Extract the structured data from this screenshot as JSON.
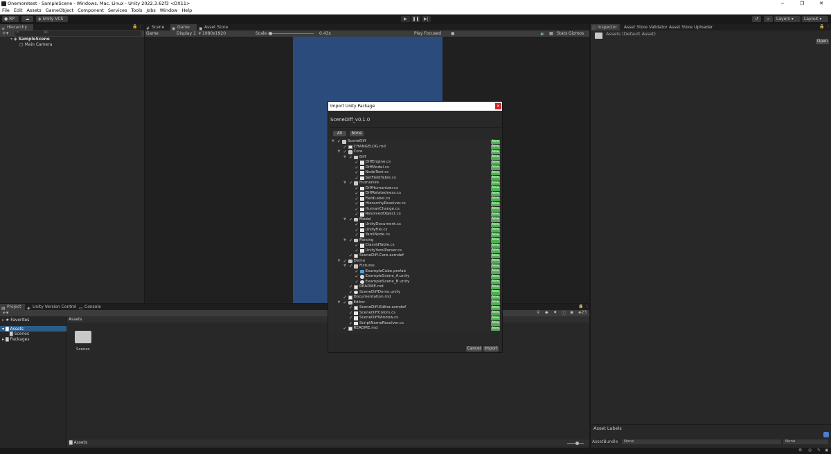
{
  "window": {
    "title": "Onemoretest - SampleScene - Windows, Mac, Linux - Unity 2022.3.62f3 <DX11>",
    "controls": [
      "─",
      "❐",
      "✕"
    ]
  },
  "menu": [
    "File",
    "Edit",
    "Assets",
    "GameObject",
    "Component",
    "Services",
    "Tools",
    "Jobs",
    "Window",
    "Help"
  ],
  "toolbar": {
    "account": "RP",
    "vcs": "Unity VCS",
    "layers": "Layers",
    "layout": "Layout"
  },
  "hierarchy": {
    "tab": "Hierarchy",
    "search_placeholder": "All",
    "scene": "SampleScene",
    "items": [
      "Main Camera"
    ]
  },
  "center": {
    "tabs": [
      "Scene",
      "Game",
      "Asset Store"
    ],
    "game_label": "Game",
    "display": "Display 1",
    "resolution": "1080x1920",
    "scale_label": "Scale",
    "scale_value": "0.43x",
    "play_mode": "Play Focused",
    "stats": "Stats",
    "gizmos": "Gizmos"
  },
  "inspector": {
    "tabs": [
      "Inspector",
      "Asset Store Validator",
      "Asset Store Uploader"
    ],
    "header": "Assets (Default Asset)",
    "open_button": "Open",
    "asset_labels": "Asset Labels",
    "asset_bundle_label": "AssetBundle",
    "asset_bundle_value": "None",
    "asset_bundle_variant": "None"
  },
  "project": {
    "tabs": [
      "Project",
      "Unity Version Control",
      "Console"
    ],
    "favorites": "Favorites",
    "tree": [
      {
        "label": "Assets",
        "level": 0
      },
      {
        "label": "Scenes",
        "level": 1
      },
      {
        "label": "Packages",
        "level": 0
      }
    ],
    "breadcrumb": "Assets",
    "folders": [
      "Scenes"
    ],
    "footer_path": "Assets",
    "hidden_count": "23"
  },
  "dialog": {
    "title": "Import Unity Package",
    "package": "SceneDiff_v0.1.0",
    "all_button": "All",
    "none_button": "None",
    "new_badge": "New",
    "cancel_button": "Cancel",
    "import_button": "Import",
    "items": [
      {
        "label": "SceneDiff",
        "depth": 0,
        "kind": "folder",
        "expand": true
      },
      {
        "label": "CHANGELOG.md",
        "depth": 1,
        "kind": "file"
      },
      {
        "label": "Core",
        "depth": 1,
        "kind": "folder",
        "expand": true
      },
      {
        "label": "Diff",
        "depth": 2,
        "kind": "folder",
        "expand": true
      },
      {
        "label": "DiffEngine.cs",
        "depth": 3,
        "kind": "cs"
      },
      {
        "label": "DiffModel.cs",
        "depth": 3,
        "kind": "cs"
      },
      {
        "label": "NodeText.cs",
        "depth": 3,
        "kind": "cs"
      },
      {
        "label": "SetFieldTable.cs",
        "depth": 3,
        "kind": "cs"
      },
      {
        "label": "Humanize",
        "depth": 2,
        "kind": "folder",
        "expand": true
      },
      {
        "label": "DiffHumanizer.cs",
        "depth": 3,
        "kind": "cs"
      },
      {
        "label": "DiffRelatedness.cs",
        "depth": 3,
        "kind": "cs"
      },
      {
        "label": "FieldLabel.cs",
        "depth": 3,
        "kind": "cs"
      },
      {
        "label": "HierarchyResolver.cs",
        "depth": 3,
        "kind": "cs"
      },
      {
        "label": "HumanChange.cs",
        "depth": 3,
        "kind": "cs"
      },
      {
        "label": "ResolvedObject.cs",
        "depth": 3,
        "kind": "cs"
      },
      {
        "label": "Model",
        "depth": 2,
        "kind": "folder",
        "expand": true
      },
      {
        "label": "UnityDocument.cs",
        "depth": 3,
        "kind": "cs"
      },
      {
        "label": "UnityFile.cs",
        "depth": 3,
        "kind": "cs"
      },
      {
        "label": "YamlNode.cs",
        "depth": 3,
        "kind": "cs"
      },
      {
        "label": "Parsing",
        "depth": 2,
        "kind": "folder",
        "expand": true
      },
      {
        "label": "ClassIdTable.cs",
        "depth": 3,
        "kind": "cs"
      },
      {
        "label": "UnityYamlParser.cs",
        "depth": 3,
        "kind": "cs"
      },
      {
        "label": "SceneDiff.Core.asmdef",
        "depth": 2,
        "kind": "file"
      },
      {
        "label": "Demo",
        "depth": 1,
        "kind": "folder",
        "expand": true
      },
      {
        "label": "Fixtures",
        "depth": 2,
        "kind": "folder",
        "expand": true
      },
      {
        "label": "ExampleCube.prefab",
        "depth": 3,
        "kind": "prefab"
      },
      {
        "label": "ExampleScene_A.unity",
        "depth": 3,
        "kind": "unity"
      },
      {
        "label": "ExampleScene_B.unity",
        "depth": 3,
        "kind": "unity"
      },
      {
        "label": "README.md",
        "depth": 2,
        "kind": "file"
      },
      {
        "label": "SceneDiffDemo.unity",
        "depth": 2,
        "kind": "unity"
      },
      {
        "label": "Documentation.md",
        "depth": 1,
        "kind": "file"
      },
      {
        "label": "Editor",
        "depth": 1,
        "kind": "folder",
        "expand": true
      },
      {
        "label": "SceneDiff.Editor.asmdef",
        "depth": 2,
        "kind": "file"
      },
      {
        "label": "SceneDiffColors.cs",
        "depth": 2,
        "kind": "cs"
      },
      {
        "label": "SceneDiffWindow.cs",
        "depth": 2,
        "kind": "cs"
      },
      {
        "label": "ScriptNameResolver.cs",
        "depth": 2,
        "kind": "cs"
      },
      {
        "label": "README.md",
        "depth": 1,
        "kind": "file"
      }
    ]
  },
  "colors": {
    "game_view": "#2b4b7c",
    "new_badge": "#4caf50",
    "close_button": "#c62828"
  }
}
